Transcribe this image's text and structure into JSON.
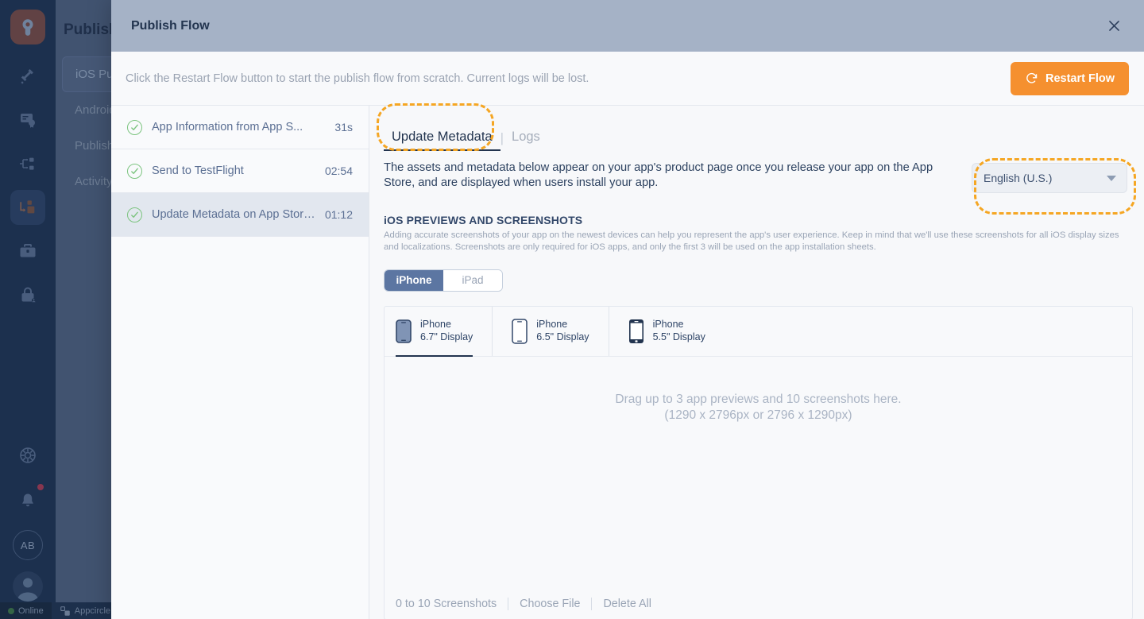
{
  "app": {
    "rail": {
      "logo_icon": "appcircle-logo-icon",
      "items": [
        {
          "name": "build-hammer-icon"
        },
        {
          "name": "signing-certificate-icon"
        },
        {
          "name": "distribution-flow-icon"
        },
        {
          "name": "publish-module-icon"
        },
        {
          "name": "toolbox-icon"
        },
        {
          "name": "enterprise-lock-icon"
        }
      ],
      "bottom": [
        {
          "name": "settings-gear-icon"
        },
        {
          "name": "notifications-bell-icon"
        }
      ],
      "avatar_initials": "AB"
    },
    "statusbar": {
      "online_label": "Online",
      "org_label": "Appcircle"
    },
    "secondary_nav": {
      "title": "Publish",
      "items": [
        {
          "label": "iOS Publish",
          "selected": true
        },
        {
          "label": "Android",
          "selected": false
        },
        {
          "label": "Publish",
          "selected": false
        },
        {
          "label": "Activity",
          "selected": false
        }
      ]
    }
  },
  "modal": {
    "title": "Publish Flow",
    "close_icon": "close-icon",
    "notice": {
      "text": "Click the Restart Flow button to start the publish flow from scratch. Current logs will be lost.",
      "restart_label": "Restart Flow",
      "restart_icon": "refresh-icon",
      "restart_color": "#f5902f"
    },
    "steps": [
      {
        "label": "App Information from App S...",
        "time": "31s",
        "status": "success",
        "current": false
      },
      {
        "label": "Send to TestFlight",
        "time": "02:54",
        "status": "success",
        "current": false
      },
      {
        "label": "Update Metadata on App Store ...",
        "time": "01:12",
        "status": "success",
        "current": true
      }
    ],
    "tabs": [
      {
        "label": "Update Metadata",
        "active": true
      },
      {
        "label": "Logs",
        "active": false
      }
    ],
    "detail": {
      "intro": "The assets and metadata below appear on your app's product page once you release your app on the App Store, and are displayed when users install your app.",
      "language": {
        "value": "English (U.S.)",
        "caret_icon": "chevron-down-icon"
      },
      "section_title": "iOS PREVIEWS AND SCREENSHOTS",
      "section_desc": "Adding accurate screenshots of your app on the newest devices can help you represent the app's user experience. Keep in mind that we'll use these screenshots for all iOS display sizes and localizations. Screenshots are only required for iOS apps, and only the first 3 will be used on the app installation sheets.",
      "platform_toggle": [
        {
          "label": "iPhone",
          "on": true
        },
        {
          "label": "iPad",
          "on": false
        }
      ],
      "devices": [
        {
          "line1": "iPhone",
          "line2": "6.7\" Display",
          "icon": "iphone-notch-icon",
          "selected": true
        },
        {
          "line1": "iPhone",
          "line2": "6.5\" Display",
          "icon": "iphone-notch-icon",
          "selected": false
        },
        {
          "line1": "iPhone",
          "line2": "5.5\" Display",
          "icon": "iphone-home-button-icon",
          "selected": false
        }
      ],
      "dropzone": {
        "line1": "Drag up to 3 app previews and 10 screenshots here.",
        "line2": "(1290 x 2796px or 2796 x 1290px)"
      },
      "footer": {
        "count_label": "0 to 10 Screenshots",
        "choose_label": "Choose File",
        "delete_label": "Delete All"
      }
    }
  },
  "annotations": {
    "color": "#f5a623",
    "items": [
      {
        "target": "update-metadata-tab"
      },
      {
        "target": "language-select"
      }
    ]
  }
}
